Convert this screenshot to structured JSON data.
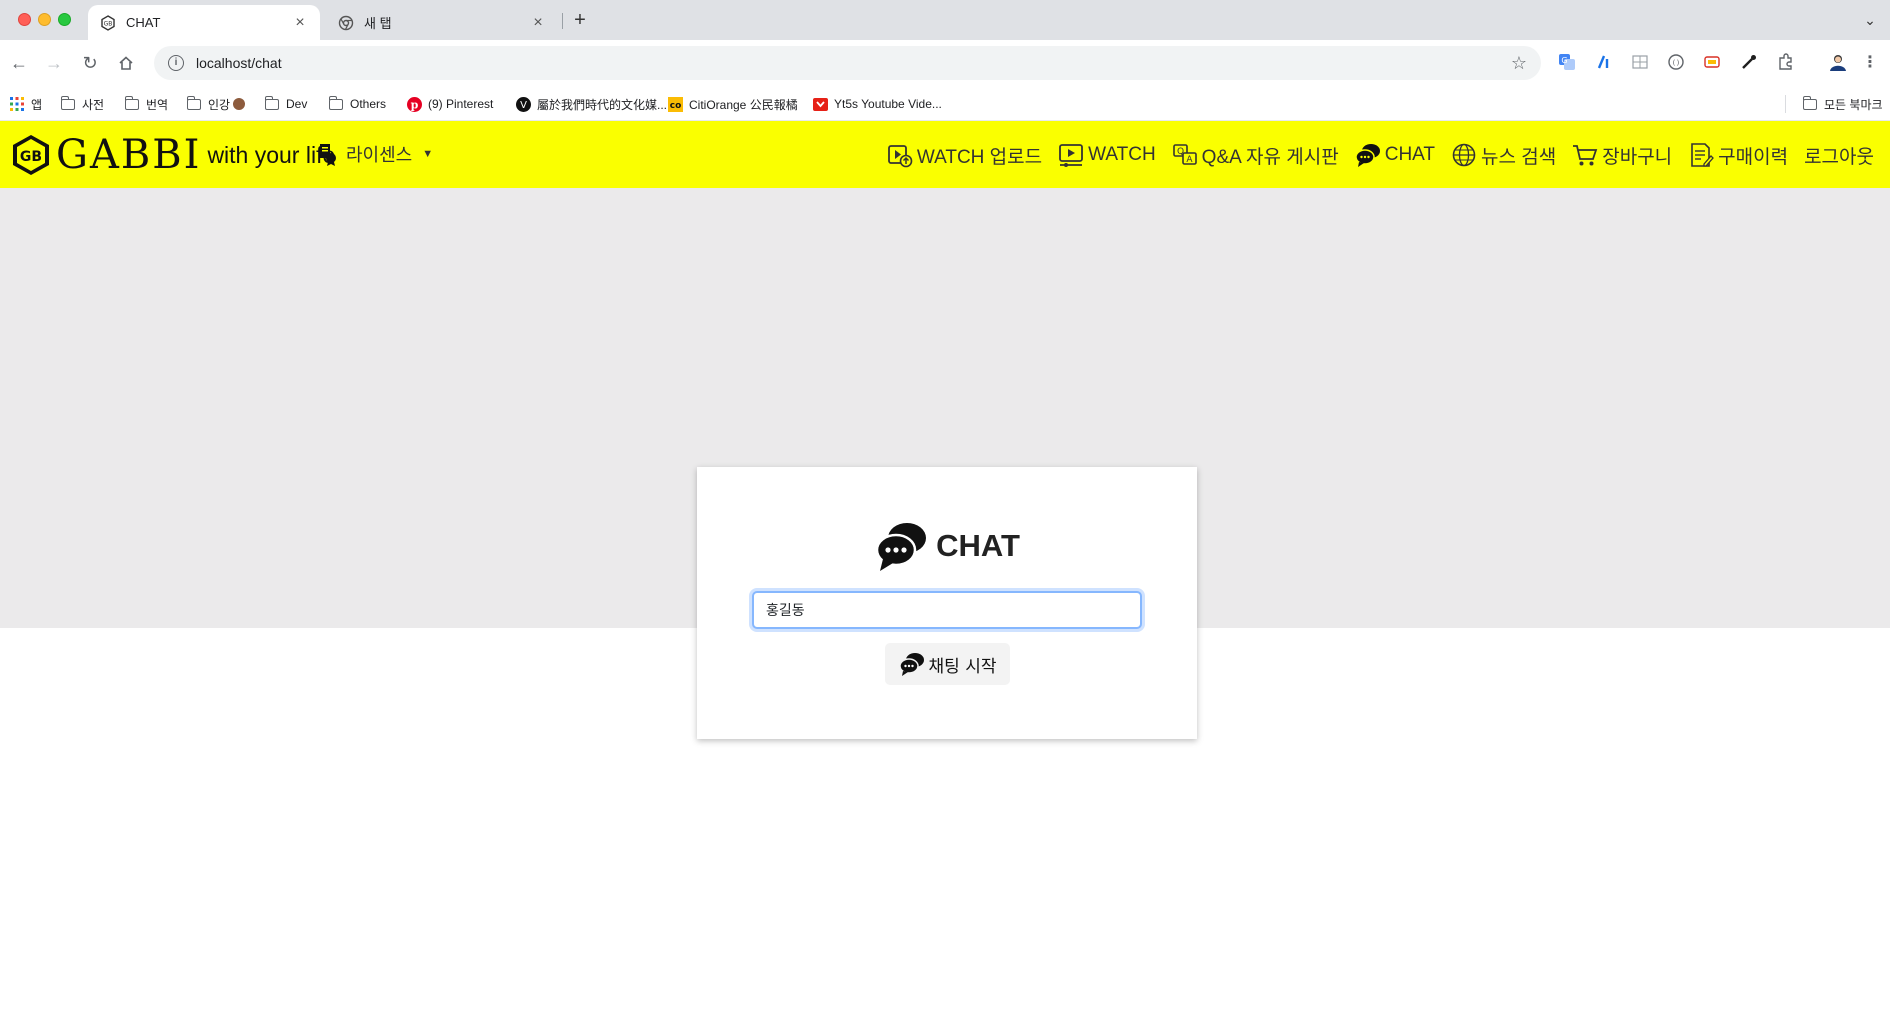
{
  "browser": {
    "tabs": [
      {
        "title": "CHAT",
        "active": true
      },
      {
        "title": "새 탭",
        "active": false
      }
    ],
    "new_tab_label": "+",
    "url": "localhost/chat",
    "bookmarks": [
      {
        "label": "앱",
        "icon": "apps-grid-icon"
      },
      {
        "label": "사전",
        "icon": "folder-icon"
      },
      {
        "label": "번역",
        "icon": "folder-icon"
      },
      {
        "label": "인강",
        "icon": "folder-icon"
      },
      {
        "label": "Dev",
        "icon": "folder-icon"
      },
      {
        "label": "Others",
        "icon": "folder-icon"
      },
      {
        "label": "(9) Pinterest",
        "icon": "pinterest-icon"
      },
      {
        "label": "屬於我們時代的文化媒...",
        "icon": "v-logo-icon"
      },
      {
        "label": "CitiOrange 公民報橘",
        "icon": "citiorange-icon"
      },
      {
        "label": "Yt5s Youtube Vide...",
        "icon": "yt5s-icon"
      }
    ],
    "all_bookmarks": "모든 북마크"
  },
  "header": {
    "logo_text": "GABBI",
    "tagline": "with your life",
    "license_menu": "라이센스",
    "nav": [
      {
        "label": "WATCH 업로드",
        "icon": "video-upload-icon"
      },
      {
        "label": "WATCH",
        "icon": "video-play-icon"
      },
      {
        "label": "Q&A 자유 게시판",
        "icon": "qa-board-icon"
      },
      {
        "label": "CHAT",
        "icon": "chat-bubbles-icon"
      },
      {
        "label": "뉴스 검색",
        "icon": "globe-icon"
      },
      {
        "label": "장바구니",
        "icon": "cart-icon"
      },
      {
        "label": "구매이력",
        "icon": "receipt-icon"
      },
      {
        "label": "로그아웃",
        "icon": ""
      }
    ],
    "brand_color": "#faff00"
  },
  "chat_entry": {
    "title": "CHAT",
    "name_value": "홍길동",
    "start_button": "채팅 시작"
  }
}
